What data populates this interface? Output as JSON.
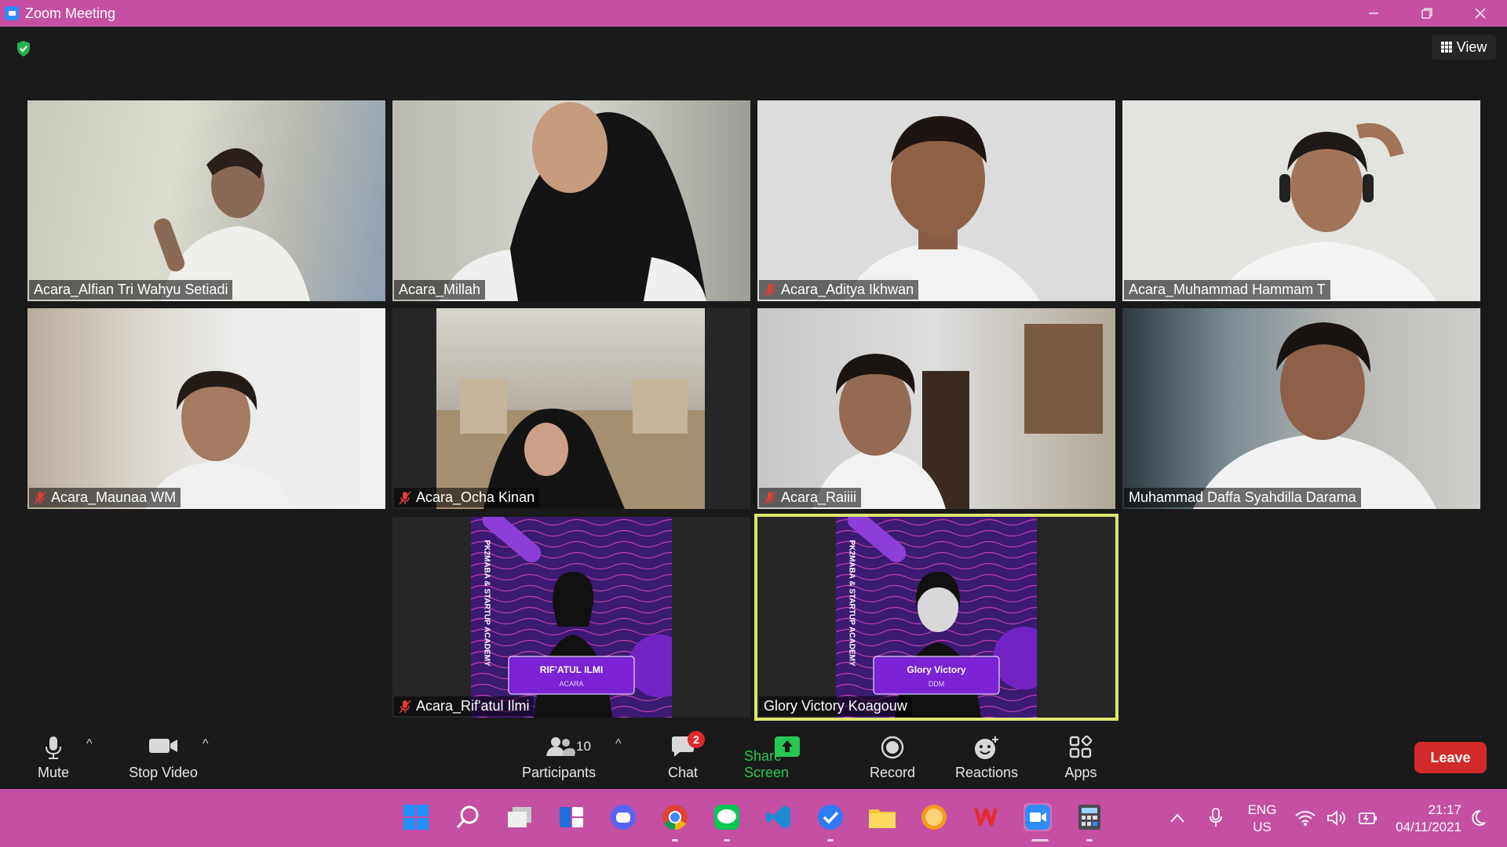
{
  "window": {
    "title": "Zoom Meeting"
  },
  "colors": {
    "accent": "#2d8cff",
    "titlebar": "#c44fa3",
    "leave": "#d22a2a",
    "active_speaker": "#dde66d",
    "share": "#26c852"
  },
  "header": {
    "view_label": "View",
    "security_icon": "shield-check-icon"
  },
  "participants": [
    {
      "name": "Acara_Alfian Tri Wahyu Setiadi",
      "muted": false
    },
    {
      "name": "Acara_Millah",
      "muted": false
    },
    {
      "name": "Acara_Aditya Ikhwan",
      "muted": true
    },
    {
      "name": "Acara_Muhammad Hammam T",
      "muted": false
    },
    {
      "name": "Acara_Maunaa WM",
      "muted": true
    },
    {
      "name": "Acara_Ocha Kinan",
      "muted": true
    },
    {
      "name": "Acara_Raiiii",
      "muted": true
    },
    {
      "name": "Muhammad Daffa Syahdilla Darama",
      "muted": false
    },
    {
      "name": "Acara_Rif'atul Ilmi",
      "muted": true,
      "poster_name": "RIF'ATUL ILMI",
      "poster_role": "ACARA",
      "poster_side": "PK2MABA & STARTUP ACADEMY"
    },
    {
      "name": "Glory Victory Koagouw",
      "muted": false,
      "active_speaker": true,
      "poster_name": "Glory Victory",
      "poster_role": "DDM",
      "poster_side": "PK2MABA & STARTUP ACADEMY"
    }
  ],
  "controls": {
    "mute_label": "Mute",
    "stop_video_label": "Stop Video",
    "participants_label": "Participants",
    "participants_count": "10",
    "chat_label": "Chat",
    "chat_badge": "2",
    "share_label": "Share Screen",
    "record_label": "Record",
    "reactions_label": "Reactions",
    "apps_label": "Apps",
    "leave_label": "Leave"
  },
  "taskbar": {
    "apps": [
      "windows-start-icon",
      "search-icon",
      "task-view-icon",
      "widgets-icon",
      "discord-icon",
      "chrome-icon",
      "line-icon",
      "vscode-icon",
      "todo-icon",
      "file-explorer-icon",
      "orange-app-icon",
      "wps-icon",
      "zoom-icon",
      "calculator-icon"
    ],
    "lang_top": "ENG",
    "lang_bottom": "US",
    "time": "21:17",
    "date": "04/11/2021"
  }
}
